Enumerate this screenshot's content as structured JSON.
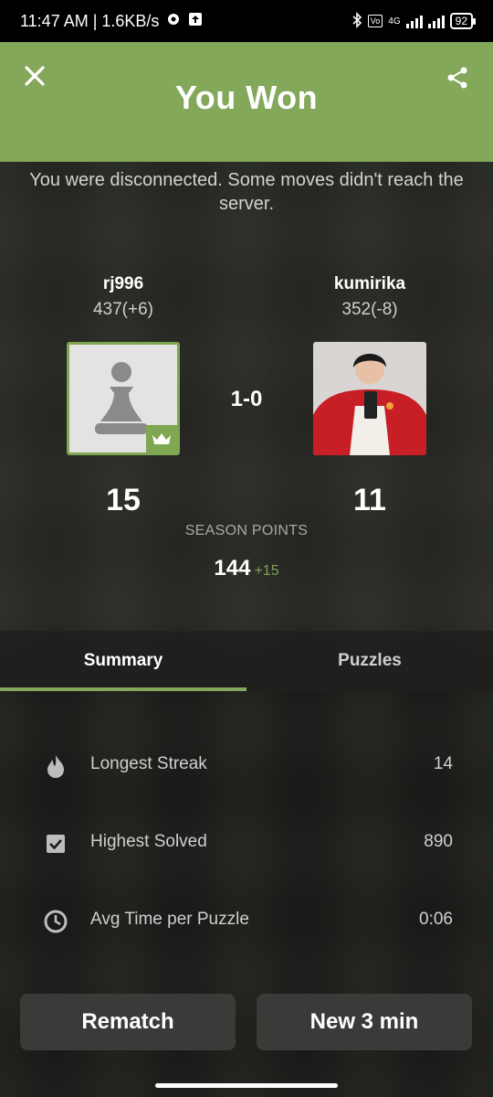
{
  "status_bar": {
    "time_speed": "11:47 AM | 1.6KB/s",
    "network": "4G",
    "battery": "92"
  },
  "header": {
    "title": "You Won"
  },
  "notice": "You were disconnected. Some moves didn't reach the server.",
  "players": [
    {
      "name": "rj996",
      "rating": "437(+6)",
      "points": "15"
    },
    {
      "name": "kumirika",
      "rating": "352(-8)",
      "points": "11"
    }
  ],
  "result": "1-0",
  "season": {
    "label": "SEASON POINTS",
    "value": "144",
    "delta": "+15"
  },
  "tabs": [
    {
      "label": "Summary"
    },
    {
      "label": "Puzzles"
    }
  ],
  "stats": [
    {
      "label": "Longest Streak",
      "value": "14",
      "icon": "flame-icon"
    },
    {
      "label": "Highest Solved",
      "value": "890",
      "icon": "checkbox-icon"
    },
    {
      "label": "Avg Time per Puzzle",
      "value": "0:06",
      "icon": "clock-icon"
    }
  ],
  "buttons": {
    "rematch": "Rematch",
    "new_game": "New 3 min"
  },
  "colors": {
    "accent": "#84a85a",
    "badge": "#7fa650"
  }
}
